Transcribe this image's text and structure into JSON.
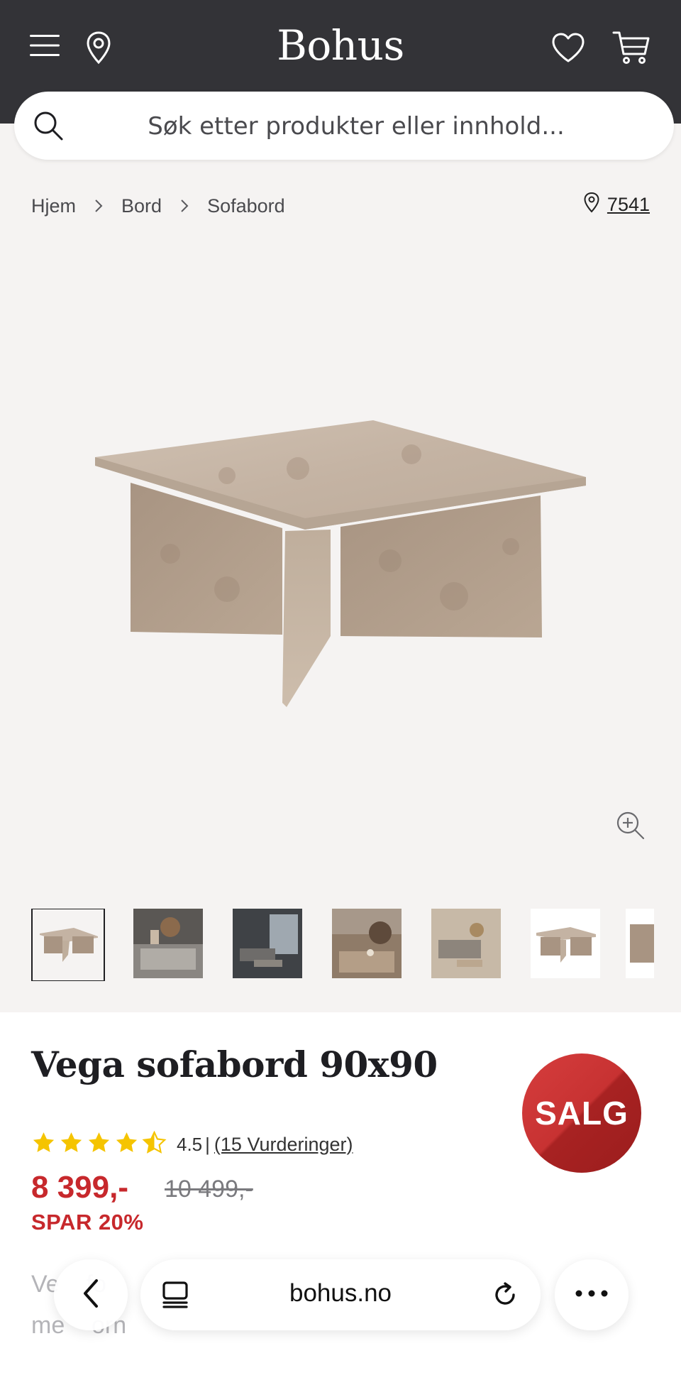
{
  "header": {
    "brand": "Bohus",
    "icons": [
      "menu-icon",
      "location-pin-icon",
      "heart-icon",
      "cart-icon"
    ]
  },
  "search": {
    "placeholder": "Søk etter produkter eller innhold..."
  },
  "breadcrumb": {
    "items": [
      "Hjem",
      "Bord",
      "Sofabord"
    ]
  },
  "store": {
    "code": "7541"
  },
  "product": {
    "title": "Vega sofabord 90x90",
    "badge": "SALG",
    "rating": 4.5,
    "rating_value_label": "4.5",
    "rating_separator": "|",
    "rating_count_label": "(15 Vurderinger)",
    "price": "8 399,-",
    "old_price": "10 499,-",
    "save_label": "SPAR 20%",
    "description_partial_line1": "Ve    fo",
    "description_partial_line2": "me    orn"
  },
  "browser": {
    "url": "bohus.no"
  },
  "colors": {
    "header_bg": "#333337",
    "gallery_bg": "#f5f3f2",
    "sale_red": "#c7282c",
    "star_yellow": "#f5c400"
  }
}
